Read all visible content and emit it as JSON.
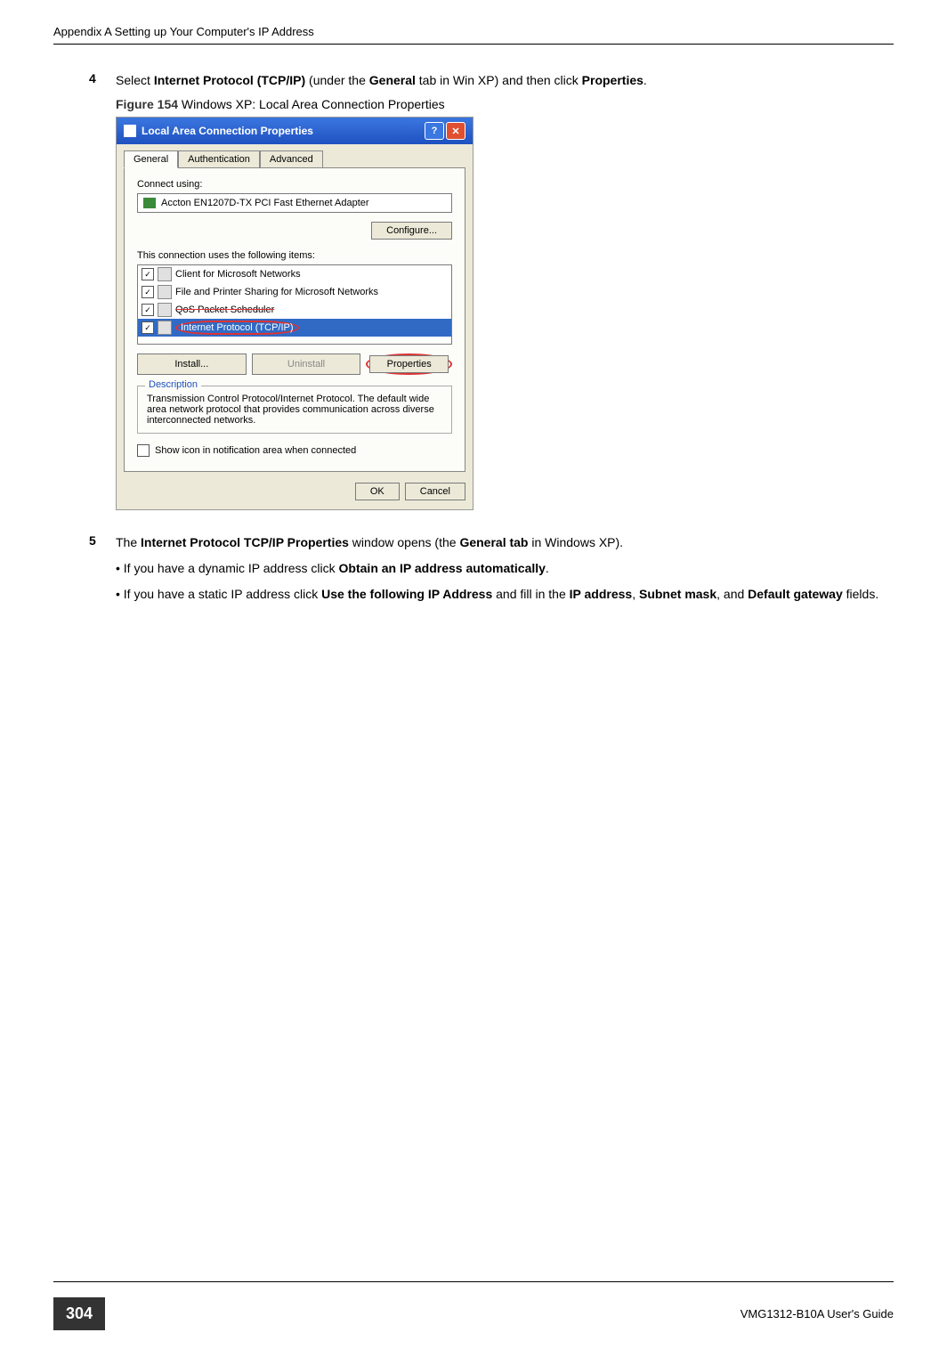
{
  "header": {
    "title": "Appendix A Setting up Your Computer's IP Address"
  },
  "step4": {
    "num": "4",
    "pre": "Select ",
    "b1": "Internet Protocol (TCP/IP)",
    "mid": " (under the ",
    "b2": "General",
    "mid2": " tab in Win XP) and then click ",
    "b3": "Properties",
    "end": "."
  },
  "figure": {
    "label": "Figure 154",
    "caption": "   Windows XP: Local Area Connection Properties"
  },
  "dialog": {
    "title": "Local Area Connection Properties",
    "help": "?",
    "close": "✕",
    "tabs": {
      "general": "General",
      "auth": "Authentication",
      "adv": "Advanced"
    },
    "connect_label": "Connect using:",
    "adapter": "Accton EN1207D-TX PCI Fast Ethernet Adapter",
    "configure": "Configure...",
    "uses_label": "This connection uses the following items:",
    "items": {
      "cli": "Client for Microsoft Networks",
      "fps": "File and Printer Sharing for Microsoft Networks",
      "qos": "QoS Packet Scheduler",
      "tcp": "Internet Protocol (TCP/IP)"
    },
    "install": "Install...",
    "uninstall": "Uninstall",
    "properties": "Properties",
    "desc_label": "Description",
    "desc": "Transmission Control Protocol/Internet Protocol. The default wide area network protocol that provides communication across diverse interconnected networks.",
    "show_icon": "Show icon in notification area when connected",
    "ok": "OK",
    "cancel": "Cancel"
  },
  "step5": {
    "num": "5",
    "pre": "The ",
    "b1": "Internet Protocol TCP/IP Properties",
    "mid": " window opens (the ",
    "b2": "General tab",
    "end": " in Windows XP)."
  },
  "bullet1": {
    "pre": "• If you have a dynamic IP address click ",
    "b1": "Obtain an IP address automatically",
    "end": "."
  },
  "bullet2": {
    "pre": "• If you have a static IP address click ",
    "b1": "Use the following IP Address",
    "mid": " and fill in the ",
    "b2": "IP address",
    "sep1": ", ",
    "b3": "Subnet mask",
    "sep2": ", and ",
    "b4": "Default gateway",
    "end": " fields."
  },
  "footer": {
    "page": "304",
    "guide": "VMG1312-B10A User's Guide"
  }
}
